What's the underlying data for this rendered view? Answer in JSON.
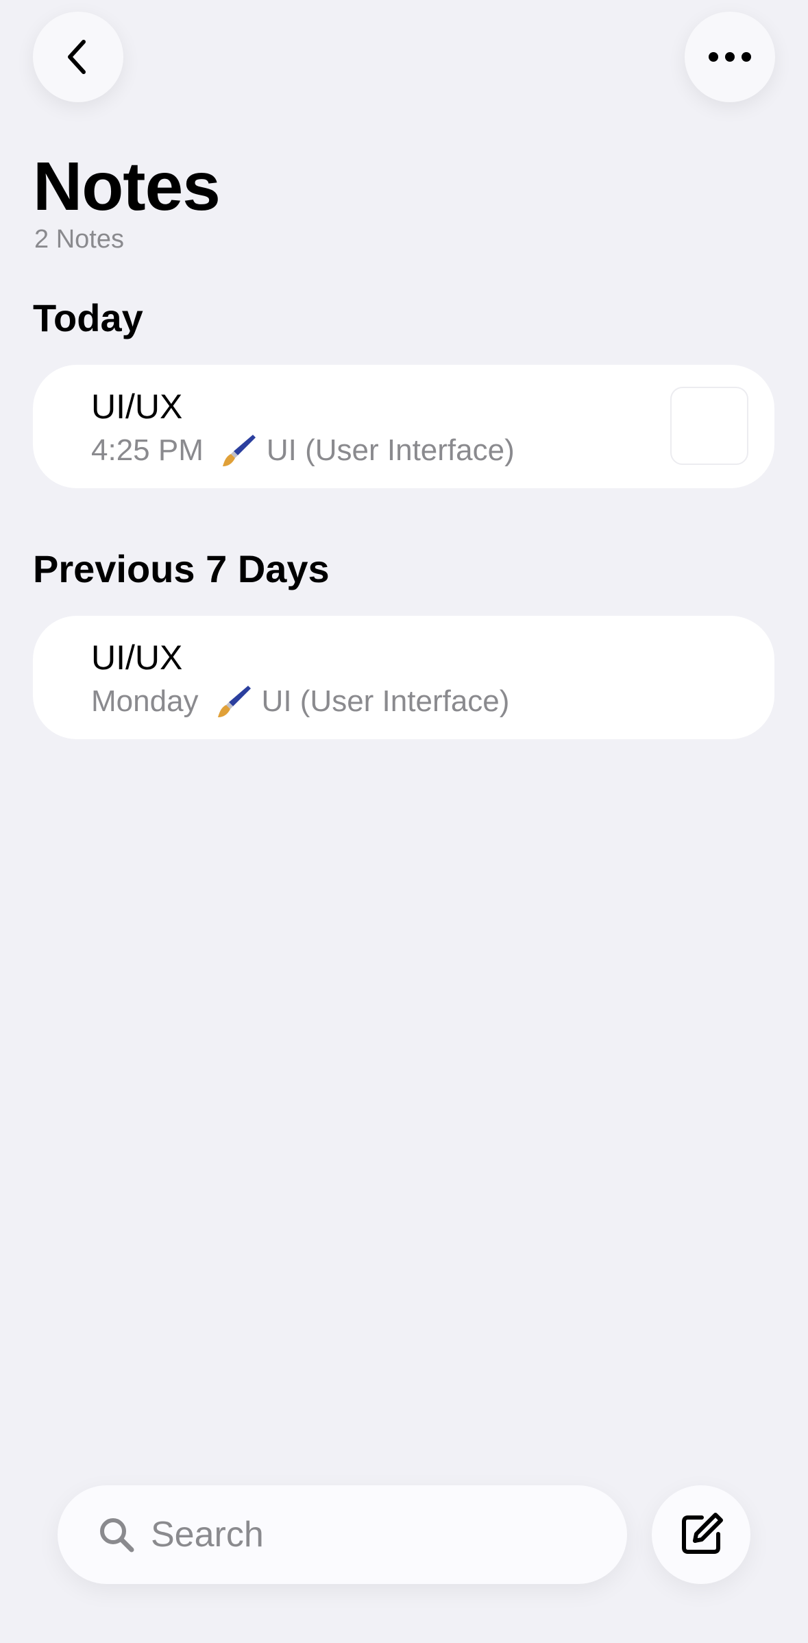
{
  "header": {
    "back_icon": "chevron-left-icon",
    "more_icon": "ellipsis-icon"
  },
  "title": "Notes",
  "count": "2 Notes",
  "sections": [
    {
      "label": "Today",
      "notes": [
        {
          "title": "UI/UX",
          "meta": "4:25 PM",
          "preview_icon": "paintbrush-icon",
          "preview": "UI (User Interface)",
          "has_thumbnail": true
        }
      ]
    },
    {
      "label": "Previous 7 Days",
      "notes": [
        {
          "title": "UI/UX",
          "meta": "Monday",
          "preview_icon": "paintbrush-icon",
          "preview": "UI (User Interface)",
          "has_thumbnail": false
        }
      ]
    }
  ],
  "search": {
    "placeholder": "Search",
    "value": "",
    "icon": "search-icon"
  },
  "compose": {
    "icon": "compose-icon"
  },
  "colors": {
    "background": "#f1f1f6",
    "card": "#ffffff",
    "secondary_text": "#8a8a8e"
  }
}
